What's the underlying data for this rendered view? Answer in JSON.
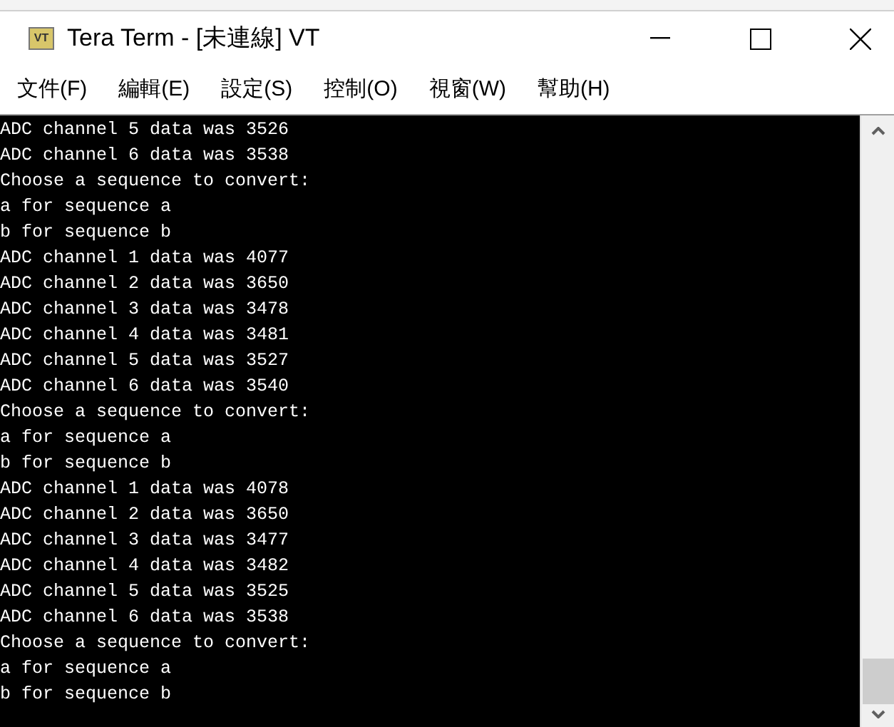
{
  "window": {
    "title": "Tera Term - [未連線] VT",
    "app_icon": "VT"
  },
  "menu": [
    "文件(F)",
    "編輯(E)",
    "設定(S)",
    "控制(O)",
    "視窗(W)",
    "幫助(H)"
  ],
  "terminal": {
    "lines": [
      "ADC channel 5 data was 3526",
      "ADC channel 6 data was 3538",
      "Choose a sequence to convert:",
      "a for sequence a",
      "b for sequence b",
      "ADC channel 1 data was 4077",
      "ADC channel 2 data was 3650",
      "ADC channel 3 data was 3478",
      "ADC channel 4 data was 3481",
      "ADC channel 5 data was 3527",
      "ADC channel 6 data was 3540",
      "Choose a sequence to convert:",
      "a for sequence a",
      "b for sequence b",
      "ADC channel 1 data was 4078",
      "ADC channel 2 data was 3650",
      "ADC channel 3 data was 3477",
      "ADC channel 4 data was 3482",
      "ADC channel 5 data was 3525",
      "ADC channel 6 data was 3538",
      "Choose a sequence to convert:",
      "a for sequence a",
      "b for sequence b"
    ]
  }
}
